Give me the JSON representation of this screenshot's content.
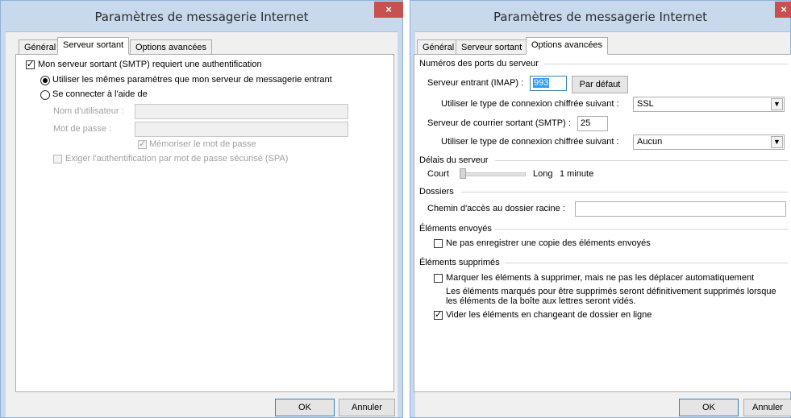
{
  "left": {
    "title": "Paramètres de messagerie Internet",
    "close": "×",
    "tabs": [
      "Général",
      "Serveur sortant",
      "Options avancées"
    ],
    "smtp_auth": {
      "label": "Mon serveur sortant (SMTP) requiert une authentification",
      "checked": true
    },
    "radio_same": "Utiliser les mêmes paramètres que mon serveur de messagerie entrant",
    "radio_login": "Se connecter à l'aide de",
    "username_label": "Nom d'utilisateur :",
    "password_label": "Mot de passe :",
    "remember_password": "Mémoriser le mot de passe",
    "spa": "Exiger l'authentification par mot de passe sécurisé (SPA)",
    "ok": "OK",
    "cancel": "Annuler"
  },
  "right": {
    "title": "Paramètres de messagerie Internet",
    "close": "×",
    "tabs": [
      "Général",
      "Serveur sortant",
      "Options avancées"
    ],
    "ports_group": "Numéros des ports du serveur",
    "imap_label": "Serveur entrant (IMAP) :",
    "imap_value": "993",
    "default_button": "Par défaut",
    "enc_label": "Utiliser le type de connexion chiffrée suivant :",
    "enc_in_value": "SSL",
    "smtp_label": "Serveur de courrier sortant (SMTP) :",
    "smtp_value": "25",
    "enc_out_value": "Aucun",
    "timeout_group": "Délais du serveur",
    "timeout_short": "Court",
    "timeout_long": "Long",
    "timeout_value": "1 minute",
    "timeout_level": 0.0,
    "folders_group": "Dossiers",
    "root_path_label": "Chemin d'accès au dossier racine :",
    "root_path_value": "",
    "sent_group": "Éléments envoyés",
    "sent_no_copy": "Ne pas enregistrer une copie des éléments envoyés",
    "deleted_group": "Éléments supprimés",
    "mark_deleted": "Marquer les éléments à supprimer, mais ne pas les déplacer automatiquement",
    "mark_note_1": "Les éléments marqués pour être supprimés seront définitivement supprimés lorsque",
    "mark_note_2": "les éléments de la boîte aux lettres seront vidés.",
    "purge_online": "Vider les éléments en changeant de dossier en ligne",
    "ok": "OK",
    "cancel": "Annuler"
  }
}
